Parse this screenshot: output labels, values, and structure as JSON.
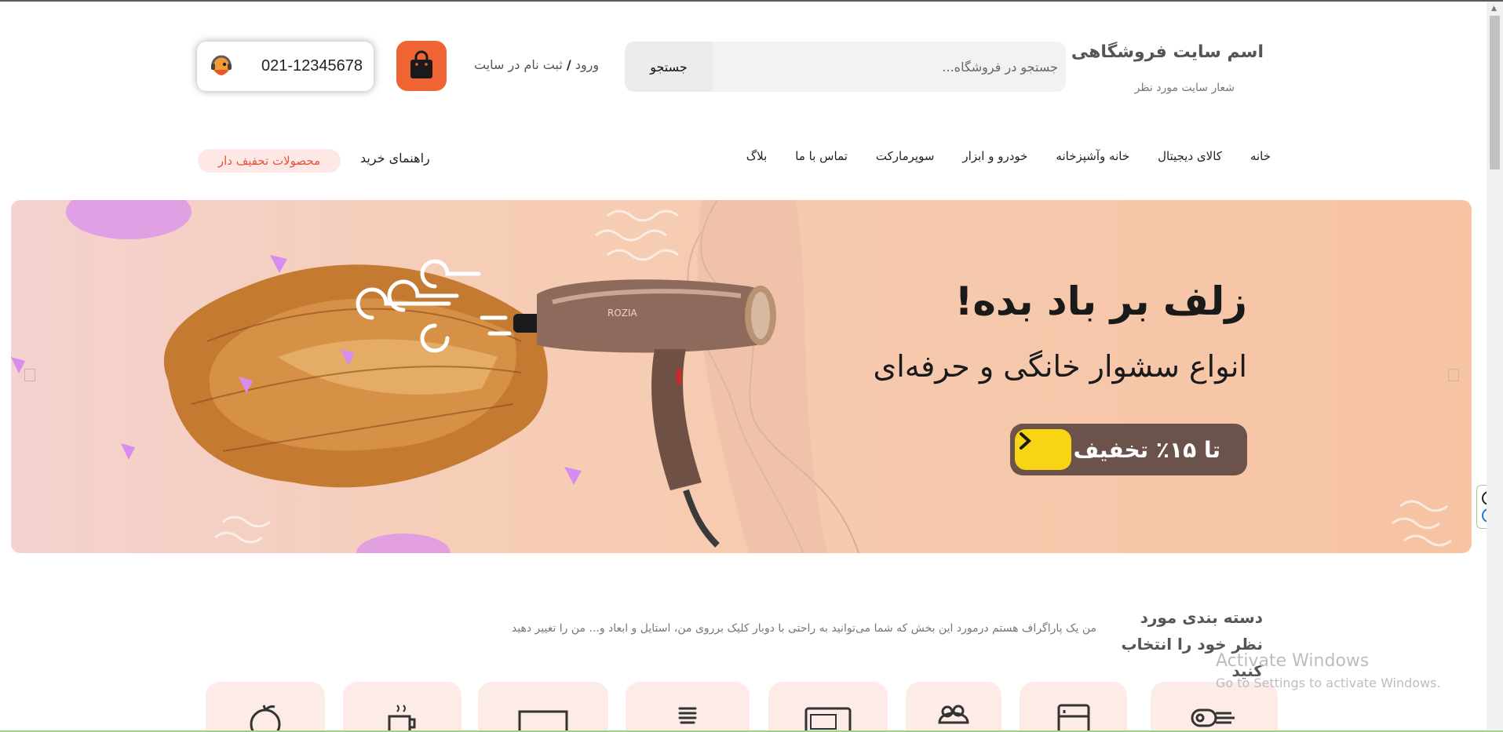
{
  "header": {
    "site_title": "اسم سایت فروشگاهی",
    "site_slogan": "شعار سایت مورد نظر",
    "search_placeholder": "جستجو در فروشگاه...",
    "search_button": "جستجو",
    "login_label": "ورود",
    "login_separator": "/",
    "register_label": "ثبت نام در سایت",
    "cart_icon": "shopping-bag-icon",
    "phone": "021-12345678",
    "support_icon": "support-headset-icon"
  },
  "nav": {
    "items": [
      "خانه",
      "کالای دیجیتال",
      "خانه وآشپزخانه",
      "خودرو و ابزار",
      "سوپرمارکت",
      "تماس با ما",
      "بلاگ"
    ],
    "guide": "راهنمای خرید",
    "discount": "محصولات تحفیف دار"
  },
  "banner": {
    "headline": "زلف بر باد بده!",
    "subhead": "انواع سشوار خانگی و حرفه‌ای",
    "cta": "تا ۱۵٪ تخفیف",
    "product_brand": "ROZIA",
    "colors": {
      "background": "#f6c3a3",
      "cta_bg": "#6b534b",
      "cta_arrow": "#f8d414"
    }
  },
  "categories": {
    "title": "دسته بندی مورد نظر خود را انتخاب کنید",
    "description": "من یک پاراگراف هستم درمورد این بخش که شما می‌توانید به راحتی با دوبار کلیک برروی من، استایل و ابعاد و... من را تغییر دهید",
    "icons": [
      "hair-dryer-icon",
      "fridge-icon",
      "cake-icon",
      "microwave-icon",
      "light-bulb-icon",
      "tv-icon",
      "coffee-cup-icon",
      "fruit-icon"
    ]
  },
  "os_overlay": {
    "activate_title": "Activate Windows",
    "activate_sub": "Go to Settings to activate Windows."
  },
  "colors": {
    "accent": "#ee6433",
    "discount_text": "#e8513a",
    "discount_bg": "#fde8e6",
    "category_card": "#fcebe6"
  }
}
